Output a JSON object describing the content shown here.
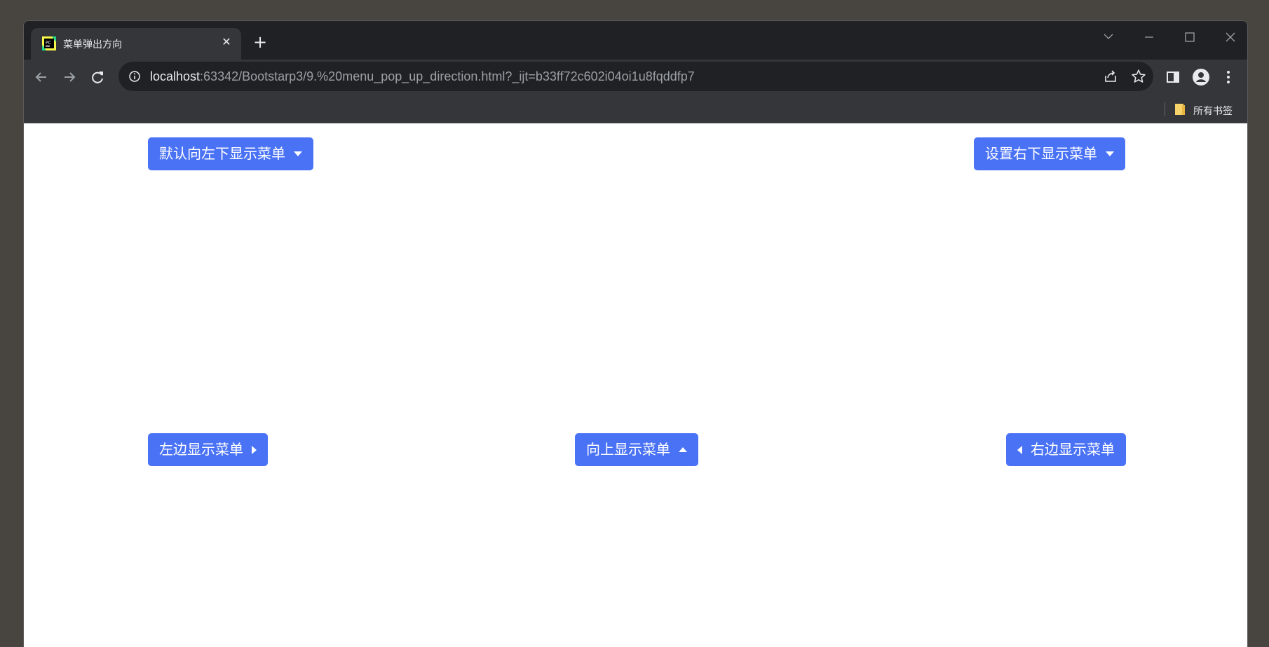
{
  "tab": {
    "title": "菜单弹出方向",
    "favicon": "pycharm-icon"
  },
  "address_bar": {
    "host": "localhost",
    "rest": ":63342/Bootstarp3/9.%20menu_pop_up_direction.html?_ijt=b33ff72c602i04oi1u8fqddfp7"
  },
  "bookmarks_bar": {
    "folder_label": "所有书签"
  },
  "buttons": {
    "default_down_left": "默认向左下显示菜单",
    "down_right": "设置右下显示菜单",
    "left": "左边显示菜单",
    "up": "向上显示菜单",
    "right": "右边显示菜单"
  },
  "colors": {
    "button_primary": "#4a72f5",
    "page_bg": "#ffffff",
    "chrome_dark": "#202124",
    "chrome_toolbar": "#35363a"
  }
}
